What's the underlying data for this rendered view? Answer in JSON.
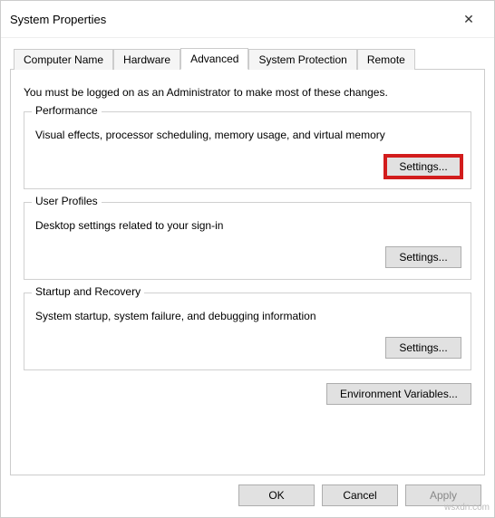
{
  "window": {
    "title": "System Properties",
    "close_label": "✕"
  },
  "tabs": {
    "computer_name": "Computer Name",
    "hardware": "Hardware",
    "advanced": "Advanced",
    "system_protection": "System Protection",
    "remote": "Remote"
  },
  "intro": "You must be logged on as an Administrator to make most of these changes.",
  "groups": {
    "performance": {
      "legend": "Performance",
      "desc": "Visual effects, processor scheduling, memory usage, and virtual memory",
      "button": "Settings..."
    },
    "user_profiles": {
      "legend": "User Profiles",
      "desc": "Desktop settings related to your sign-in",
      "button": "Settings..."
    },
    "startup_recovery": {
      "legend": "Startup and Recovery",
      "desc": "System startup, system failure, and debugging information",
      "button": "Settings..."
    }
  },
  "env_button": "Environment Variables...",
  "dialog_buttons": {
    "ok": "OK",
    "cancel": "Cancel",
    "apply": "Apply"
  },
  "watermark": "wsxdn.com"
}
